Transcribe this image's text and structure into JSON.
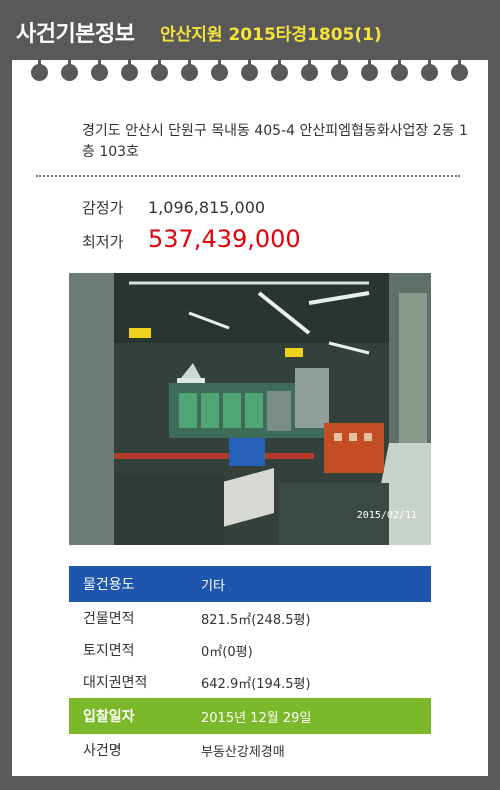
{
  "header": {
    "title": "사건기본정보",
    "case_ref": "안산지원 2015타경1805(1)"
  },
  "address": "경기도 안산시 단원구 목내동 405-4 안산피엠협동화사업장 2동 1층 103호",
  "prices": {
    "appraisal_label": "감정가",
    "appraisal_value": "1,096,815,000",
    "minimum_label": "최저가",
    "minimum_value": "537,439,000"
  },
  "photo": {
    "date_stamp": "2015/02/11"
  },
  "details": [
    {
      "label": "물건용도",
      "value": "기타"
    },
    {
      "label": "건물면적",
      "value": "821.5㎡(248.5평)"
    },
    {
      "label": "토지면적",
      "value": "0㎡(0평)"
    },
    {
      "label": "대지권면적",
      "value": "642.9㎡(194.5평)"
    },
    {
      "label": "입찰일자",
      "value": "2015년 12월 29일"
    },
    {
      "label": "사건명",
      "value": "부동산강제경매"
    }
  ],
  "colors": {
    "header_bg": "#595959",
    "accent_yellow": "#f5e23a",
    "min_price": "#e3000b",
    "blue_row": "#1f56ad",
    "green_row": "#7bb92a"
  }
}
